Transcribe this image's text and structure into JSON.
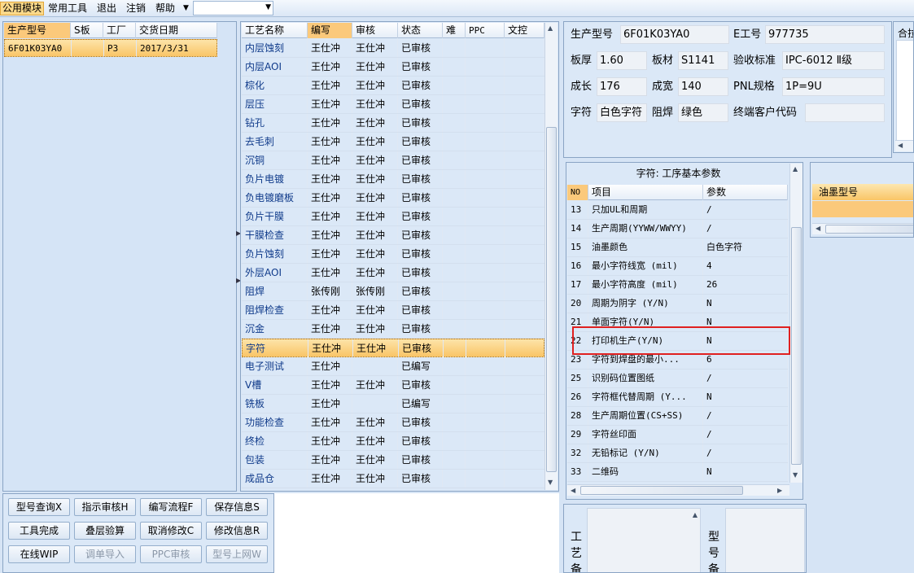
{
  "menu": {
    "items": [
      "公用模块",
      "常用工具",
      "退出",
      "注销",
      "帮助"
    ],
    "combo_value": ""
  },
  "orders": {
    "columns": [
      "生产型号",
      "S板",
      "工厂",
      "交货日期"
    ],
    "rows": [
      {
        "model": "6F01K03YA0",
        "s_board": "",
        "factory": "P3",
        "date": "2017/3/31"
      }
    ]
  },
  "process": {
    "columns": [
      "工艺名称",
      "编写",
      "审核",
      "状态",
      "难",
      "PPC",
      "文控"
    ],
    "rows": [
      {
        "name": "内层蚀刻",
        "writer": "王仕冲",
        "reviewer": "王仕冲",
        "status": "已审核"
      },
      {
        "name": "内层AOI",
        "writer": "王仕冲",
        "reviewer": "王仕冲",
        "status": "已审核"
      },
      {
        "name": "棕化",
        "writer": "王仕冲",
        "reviewer": "王仕冲",
        "status": "已审核"
      },
      {
        "name": "层压",
        "writer": "王仕冲",
        "reviewer": "王仕冲",
        "status": "已审核"
      },
      {
        "name": "钻孔",
        "writer": "王仕冲",
        "reviewer": "王仕冲",
        "status": "已审核"
      },
      {
        "name": "去毛刺",
        "writer": "王仕冲",
        "reviewer": "王仕冲",
        "status": "已审核"
      },
      {
        "name": "沉铜",
        "writer": "王仕冲",
        "reviewer": "王仕冲",
        "status": "已审核"
      },
      {
        "name": "负片电镀",
        "writer": "王仕冲",
        "reviewer": "王仕冲",
        "status": "已审核"
      },
      {
        "name": "负电镀磨板",
        "writer": "王仕冲",
        "reviewer": "王仕冲",
        "status": "已审核"
      },
      {
        "name": "负片干膜",
        "writer": "王仕冲",
        "reviewer": "王仕冲",
        "status": "已审核"
      },
      {
        "name": "干膜检查",
        "writer": "王仕冲",
        "reviewer": "王仕冲",
        "status": "已审核"
      },
      {
        "name": "负片蚀刻",
        "writer": "王仕冲",
        "reviewer": "王仕冲",
        "status": "已审核"
      },
      {
        "name": "外层AOI",
        "writer": "王仕冲",
        "reviewer": "王仕冲",
        "status": "已审核"
      },
      {
        "name": "阻焊",
        "writer": "张传刚",
        "reviewer": "张传刚",
        "status": "已审核"
      },
      {
        "name": "阻焊检查",
        "writer": "王仕冲",
        "reviewer": "王仕冲",
        "status": "已审核"
      },
      {
        "name": "沉金",
        "writer": "王仕冲",
        "reviewer": "王仕冲",
        "status": "已审核"
      },
      {
        "name": "字符",
        "writer": "王仕冲",
        "reviewer": "王仕冲",
        "status": "已审核"
      },
      {
        "name": "电子测试",
        "writer": "王仕冲",
        "reviewer": "",
        "status": "已编写"
      },
      {
        "name": "V槽",
        "writer": "王仕冲",
        "reviewer": "王仕冲",
        "status": "已审核"
      },
      {
        "name": "铣板",
        "writer": "王仕冲",
        "reviewer": "",
        "status": "已编写"
      },
      {
        "name": "功能检查",
        "writer": "王仕冲",
        "reviewer": "王仕冲",
        "status": "已审核"
      },
      {
        "name": "终检",
        "writer": "王仕冲",
        "reviewer": "王仕冲",
        "status": "已审核"
      },
      {
        "name": "包装",
        "writer": "王仕冲",
        "reviewer": "王仕冲",
        "status": "已审核"
      },
      {
        "name": "成品仓",
        "writer": "王仕冲",
        "reviewer": "王仕冲",
        "status": "已审核"
      }
    ],
    "selected_index": 16
  },
  "info": {
    "model_label": "生产型号",
    "model_value": "6F01K03YA0",
    "eng_label": "E工号",
    "eng_value": "977735",
    "thickness_label": "板厚",
    "thickness_value": "1.60",
    "material_label": "板材",
    "material_value": "S1141",
    "standard_label": "验收标准",
    "standard_value": "IPC-6012 Ⅱ级",
    "length_label": "成长",
    "length_value": "176",
    "width_label": "成宽",
    "width_value": "140",
    "pnl_label": "PNL规格",
    "pnl_value": "1P=9U",
    "char_label": "字符",
    "char_value": "白色字符",
    "mask_label": "阻焊",
    "mask_value": "绿色",
    "customer_label": "终端客户代码",
    "customer_value": "",
    "cut_label": "合拉"
  },
  "params": {
    "title": "字符: 工序基本参数",
    "columns": [
      "NO",
      "项目",
      "参数"
    ],
    "rows": [
      {
        "no": "13",
        "item": "只加UL和周期",
        "value": "/"
      },
      {
        "no": "14",
        "item": "生产周期(YYWW/WWYY)",
        "value": "/"
      },
      {
        "no": "15",
        "item": "油墨颜色",
        "value": "白色字符"
      },
      {
        "no": "16",
        "item": "最小字符线宽 (mil)",
        "value": "4"
      },
      {
        "no": "17",
        "item": "最小字符高度 (mil)",
        "value": "26"
      },
      {
        "no": "20",
        "item": "周期为阴字 (Y/N)",
        "value": "N"
      },
      {
        "no": "21",
        "item": "单面字符(Y/N)",
        "value": "N"
      },
      {
        "no": "22",
        "item": "打印机生产(Y/N)",
        "value": "N"
      },
      {
        "no": "23",
        "item": "字符到焊盘的最小...",
        "value": "6"
      },
      {
        "no": "25",
        "item": "识别码位置图纸",
        "value": "/"
      },
      {
        "no": "26",
        "item": "字符框代替周期 (Y...",
        "value": "N"
      },
      {
        "no": "28",
        "item": "生产周期位置(CS+SS)",
        "value": "/"
      },
      {
        "no": "29",
        "item": "字符丝印面",
        "value": "/"
      },
      {
        "no": "32",
        "item": "无铅标记 (Y/N)",
        "value": "/"
      },
      {
        "no": "33",
        "item": "二维码",
        "value": "N"
      }
    ],
    "highlight_color": "#e02020"
  },
  "ink": {
    "column": "油墨型号"
  },
  "buttons": [
    {
      "label": "型号查询X",
      "enabled": true
    },
    {
      "label": "指示审核H",
      "enabled": true
    },
    {
      "label": "编写流程F",
      "enabled": true
    },
    {
      "label": "保存信息S",
      "enabled": true
    },
    {
      "label": "工具完成",
      "enabled": true
    },
    {
      "label": "叠层验算",
      "enabled": true
    },
    {
      "label": "取消修改C",
      "enabled": true
    },
    {
      "label": "修改信息R",
      "enabled": true
    },
    {
      "label": "在线WIP",
      "enabled": true
    },
    {
      "label": "调单导入",
      "enabled": false
    },
    {
      "label": "PPC审核",
      "enabled": false
    },
    {
      "label": "型号上网W",
      "enabled": false
    }
  ],
  "notes": {
    "process_label": "工艺备",
    "model_label": "型号备"
  },
  "colors": {
    "accent": "#f9c567",
    "header_bg": "#e6eef8",
    "panel_bg": "#dbe8f7"
  }
}
